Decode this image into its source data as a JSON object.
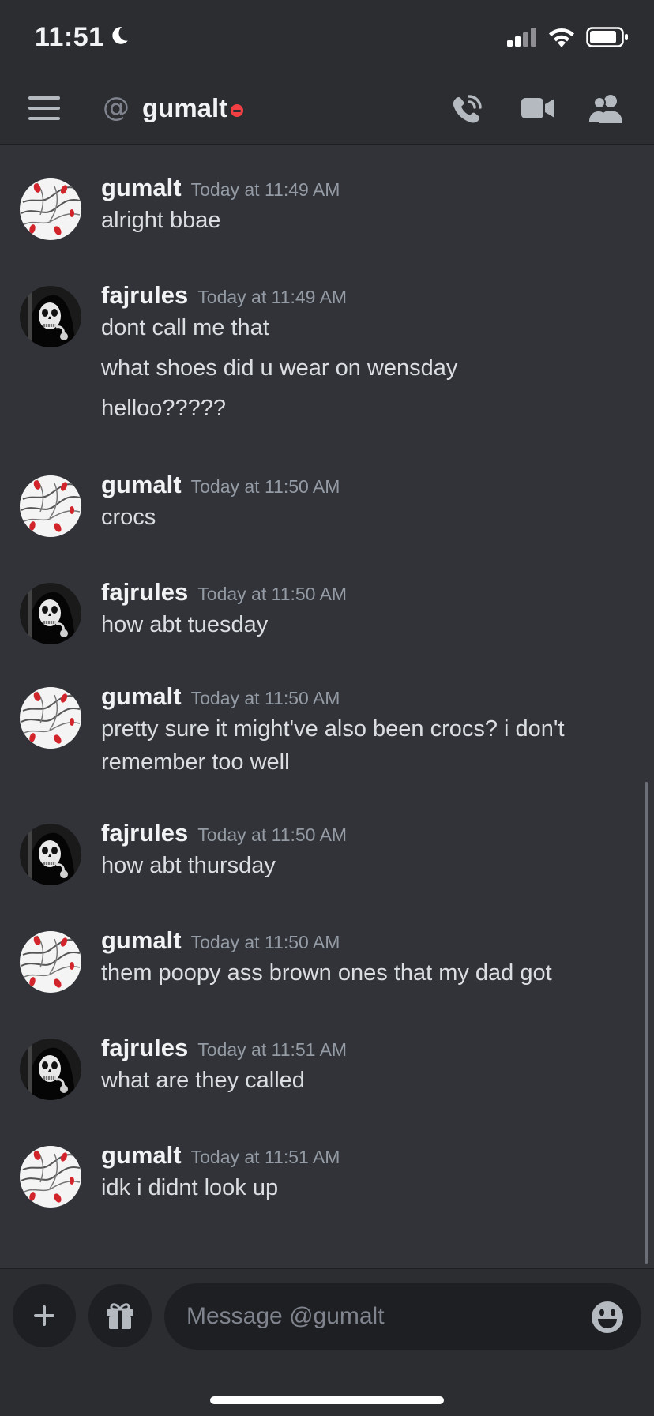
{
  "status_bar": {
    "time": "11:51",
    "icons": [
      "moon-icon",
      "cellular-signal-icon",
      "wifi-icon",
      "battery-icon"
    ]
  },
  "header": {
    "at_symbol": "@",
    "title": "gumalt",
    "status": "do-not-disturb",
    "icons": [
      "hamburger-menu-icon",
      "phone-call-icon",
      "video-call-icon",
      "members-icon"
    ]
  },
  "messages": [
    {
      "author": "gumalt",
      "timestamp": "Today at 11:49 AM",
      "avatar": "gumalt-avatar",
      "lines": [
        "alright bbae"
      ]
    },
    {
      "author": "fajrules",
      "timestamp": "Today at 11:49 AM",
      "avatar": "fajrules-avatar",
      "lines": [
        "dont call me that",
        "what shoes did u wear on wensday",
        "helloo?????"
      ]
    },
    {
      "author": "gumalt",
      "timestamp": "Today at 11:50 AM",
      "avatar": "gumalt-avatar",
      "lines": [
        "crocs"
      ]
    },
    {
      "author": "fajrules",
      "timestamp": "Today at 11:50 AM",
      "avatar": "fajrules-avatar",
      "lines": [
        "how abt tuesday"
      ]
    },
    {
      "author": "gumalt",
      "timestamp": "Today at 11:50 AM",
      "avatar": "gumalt-avatar",
      "lines": [
        "pretty sure it might've also been crocs? i don't",
        "remember too well"
      ]
    },
    {
      "author": "fajrules",
      "timestamp": "Today at 11:50 AM",
      "avatar": "fajrules-avatar",
      "lines": [
        "how abt thursday"
      ]
    },
    {
      "author": "gumalt",
      "timestamp": "Today at 11:50 AM",
      "avatar": "gumalt-avatar",
      "lines": [
        "them poopy ass brown ones that my dad got"
      ]
    },
    {
      "author": "fajrules",
      "timestamp": "Today at 11:51 AM",
      "avatar": "fajrules-avatar",
      "lines": [
        "what are they called"
      ]
    },
    {
      "author": "gumalt",
      "timestamp": "Today at 11:51 AM",
      "avatar": "gumalt-avatar",
      "lines": [
        "idk i didnt look up"
      ]
    }
  ],
  "composer": {
    "placeholder": "Message @gumalt",
    "icons": [
      "plus-icon",
      "gift-icon",
      "emoji-icon"
    ]
  },
  "colors": {
    "background": "#313338",
    "header": "#2b2d31",
    "input": "#1e1f22",
    "dnd": "#f23f43"
  }
}
